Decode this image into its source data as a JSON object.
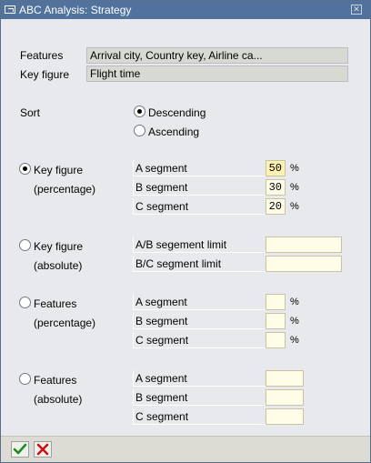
{
  "window": {
    "title": "ABC Analysis: Strategy"
  },
  "header": {
    "features_label": "Features",
    "features_value": "Arrival city, Country key, Airline ca...",
    "keyfigure_label": "Key figure",
    "keyfigure_value": "Flight time"
  },
  "sort": {
    "label": "Sort",
    "descending": "Descending",
    "ascending": "Ascending",
    "selected": "Descending"
  },
  "options": {
    "kf_pct": {
      "line1": "Key figure",
      "line2": "(percentage)",
      "selected": true
    },
    "kf_abs": {
      "line1": "Key figure",
      "line2": "(absolute)",
      "selected": false
    },
    "ft_pct": {
      "line1": "Features",
      "line2": "(percentage)",
      "selected": false
    },
    "ft_abs": {
      "line1": "Features",
      "line2": "(absolute)",
      "selected": false
    }
  },
  "segments": {
    "kf_pct": [
      {
        "label": "A segment",
        "value": "50",
        "unit": "%"
      },
      {
        "label": "B segment",
        "value": "30",
        "unit": "%"
      },
      {
        "label": "C segment",
        "value": "20",
        "unit": "%"
      }
    ],
    "kf_abs": [
      {
        "label": "A/B segement limit",
        "value": ""
      },
      {
        "label": "B/C segment limit",
        "value": ""
      }
    ],
    "ft_pct": [
      {
        "label": "A segment",
        "value": "",
        "unit": "%"
      },
      {
        "label": "B segment",
        "value": "",
        "unit": "%"
      },
      {
        "label": "C segment",
        "value": "",
        "unit": "%"
      }
    ],
    "ft_abs": [
      {
        "label": "A segment",
        "value": ""
      },
      {
        "label": "B segment",
        "value": ""
      },
      {
        "label": "C segment",
        "value": ""
      }
    ]
  },
  "footer": {
    "confirm_icon": "checkmark-icon",
    "cancel_icon": "cross-icon"
  },
  "colors": {
    "titlebar": "#50729c",
    "active_input": "#fff1b0",
    "confirm": "#1f8a1f",
    "cancel": "#cc1111"
  }
}
